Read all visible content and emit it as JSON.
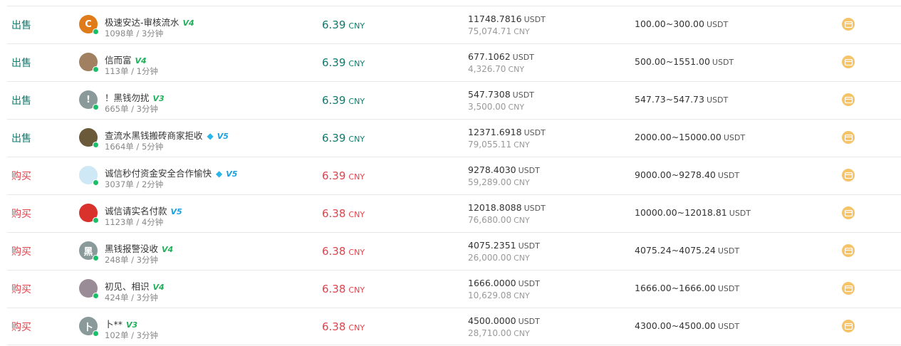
{
  "colors": {
    "sell": "#0e7a6e",
    "buy": "#e0434c",
    "online_dot": "#1bbf6a",
    "payment_icon": "#f5c368"
  },
  "units": {
    "cny": "CNY",
    "usdt": "USDT"
  },
  "rows": [
    {
      "side": "出售",
      "side_type": "sell",
      "name": "极速安达-审核流水",
      "badge": "V4",
      "badge_color": "g",
      "diamond": false,
      "stats": "1098单 / 3分钟",
      "price": "6.39",
      "amount_usdt": "11748.7816",
      "amount_cny": "75,074.71",
      "limit": "100.00~300.00",
      "avatar_icon": "logo-icon",
      "avatar_bg": "#e07b1a",
      "avatar_text": "C"
    },
    {
      "side": "出售",
      "side_type": "sell",
      "name": "信而富",
      "badge": "V4",
      "badge_color": "g",
      "diamond": false,
      "stats": "113单 / 1分钟",
      "price": "6.39",
      "amount_usdt": "677.1062",
      "amount_cny": "4,326.70",
      "limit": "500.00~1551.00",
      "avatar_icon": "photo-avatar-icon",
      "avatar_bg": "#a08060",
      "avatar_text": ""
    },
    {
      "side": "出售",
      "side_type": "sell",
      "name": "！黑钱勿扰",
      "badge": "V3",
      "badge_color": "g",
      "diamond": false,
      "stats": "665单 / 3分钟",
      "price": "6.39",
      "amount_usdt": "547.7308",
      "amount_cny": "3,500.00",
      "limit": "547.73~547.73",
      "avatar_icon": "letter-avatar-icon",
      "avatar_bg": "#8a9a9a",
      "avatar_text": "!"
    },
    {
      "side": "出售",
      "side_type": "sell",
      "name": "查流水黑钱搬砖商家拒收",
      "badge": "V5",
      "badge_color": "b",
      "diamond": true,
      "stats": "1664单 / 5分钟",
      "price": "6.39",
      "amount_usdt": "12371.6918",
      "amount_cny": "79,055.11",
      "limit": "2000.00~15000.00",
      "avatar_icon": "cartoon-avatar-icon",
      "avatar_bg": "#6b5a3a",
      "avatar_text": ""
    },
    {
      "side": "购买",
      "side_type": "buy",
      "name": "诚信秒付资金安全合作愉快",
      "badge": "V5",
      "badge_color": "b",
      "diamond": true,
      "stats": "3037单 / 2分钟",
      "price": "6.39",
      "amount_usdt": "9278.4030",
      "amount_cny": "59,289.00",
      "limit": "9000.00~9278.40",
      "avatar_icon": "bubble-avatar-icon",
      "avatar_bg": "#cfe8f5",
      "avatar_text": ""
    },
    {
      "side": "购买",
      "side_type": "buy",
      "name": "诚信请实名付款",
      "badge": "V5",
      "badge_color": "b",
      "diamond": false,
      "stats": "1123单 / 4分钟",
      "price": "6.38",
      "amount_usdt": "12018.8088",
      "amount_cny": "76,680.00",
      "limit": "10000.00~12018.81",
      "avatar_icon": "fruit-avatar-icon",
      "avatar_bg": "#d9312b",
      "avatar_text": ""
    },
    {
      "side": "购买",
      "side_type": "buy",
      "name": "黑钱报警没收",
      "badge": "V4",
      "badge_color": "g",
      "diamond": false,
      "stats": "248单 / 3分钟",
      "price": "6.38",
      "amount_usdt": "4075.2351",
      "amount_cny": "26,000.00",
      "limit": "4075.24~4075.24",
      "avatar_icon": "letter-avatar-icon",
      "avatar_bg": "#8a9a9a",
      "avatar_text": "黑"
    },
    {
      "side": "购买",
      "side_type": "buy",
      "name": "初见、相识",
      "badge": "V4",
      "badge_color": "g",
      "diamond": false,
      "stats": "424单 / 3分钟",
      "price": "6.38",
      "amount_usdt": "1666.0000",
      "amount_cny": "10,629.08",
      "limit": "1666.00~1666.00",
      "avatar_icon": "photo-avatar-icon",
      "avatar_bg": "#9a8c96",
      "avatar_text": ""
    },
    {
      "side": "购买",
      "side_type": "buy",
      "name": "卜**",
      "badge": "V3",
      "badge_color": "g",
      "diamond": false,
      "stats": "102单 / 3分钟",
      "price": "6.38",
      "amount_usdt": "4500.0000",
      "amount_cny": "28,710.00",
      "limit": "4300.00~4500.00",
      "avatar_icon": "letter-avatar-icon",
      "avatar_bg": "#8a9a9a",
      "avatar_text": "卜"
    }
  ]
}
